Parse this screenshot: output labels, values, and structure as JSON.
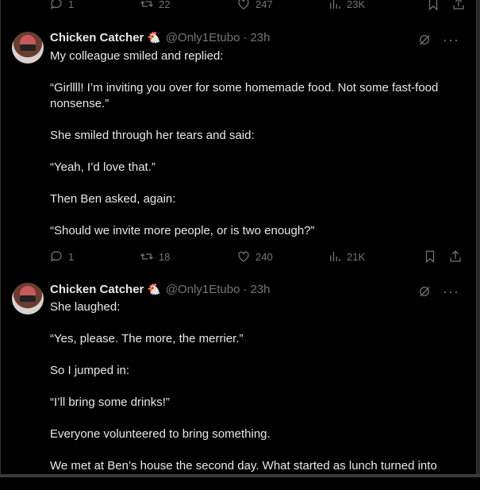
{
  "top_actions": {
    "replies": "1",
    "reposts": "22",
    "likes": "247",
    "views": "23K"
  },
  "tweets": [
    {
      "author": "Chicken Catcher",
      "emoji": "🐔",
      "handle": "@Only1Etubo",
      "time": "23h",
      "paragraphs": [
        "My colleague smiled and replied:",
        "“Girllll! I’m inviting you over for some homemade food. Not some fast-food nonsense.”",
        "She smiled through her tears and said:",
        "“Yeah, I’d love that.”",
        "Then Ben asked, again:",
        "“Should we invite more people, or is two enough?”"
      ],
      "actions": {
        "replies": "1",
        "reposts": "18",
        "likes": "240",
        "views": "21K"
      }
    },
    {
      "author": "Chicken Catcher",
      "emoji": "🐔",
      "handle": "@Only1Etubo",
      "time": "23h",
      "paragraphs": [
        "She laughed:",
        "“Yes, please. The more, the merrier.”",
        "So I jumped in:",
        "“I’ll bring some drinks!”",
        "Everyone volunteered to bring something.",
        "We met at Ben’s house the second day. What started as lunch turned into"
      ]
    }
  ]
}
